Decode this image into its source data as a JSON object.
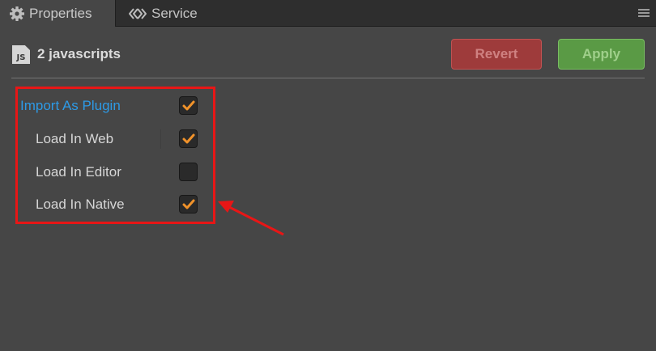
{
  "tabs": {
    "properties": {
      "label": "Properties",
      "icon": "gear-icon"
    },
    "service": {
      "label": "Service",
      "icon": "service-chevrons-icon"
    },
    "menu_icon": "hamburger-menu-icon"
  },
  "header": {
    "badge": "JS",
    "title": "2 javascripts",
    "revert_label": "Revert",
    "apply_label": "Apply"
  },
  "properties": [
    {
      "label": "Import As Plugin",
      "checked": true,
      "highlight": true
    },
    {
      "label": "Load In Web",
      "checked": true,
      "highlight": false
    },
    {
      "label": "Load In Editor",
      "checked": false,
      "highlight": false
    },
    {
      "label": "Load In Native",
      "checked": true,
      "highlight": false
    }
  ],
  "colors": {
    "panel_bg": "#464646",
    "accent_blue": "#2d9ae6",
    "check_orange": "#f0922a",
    "annotation_red": "#e81616",
    "revert_red": "#9e3b3b",
    "apply_green": "#5a9a45"
  }
}
